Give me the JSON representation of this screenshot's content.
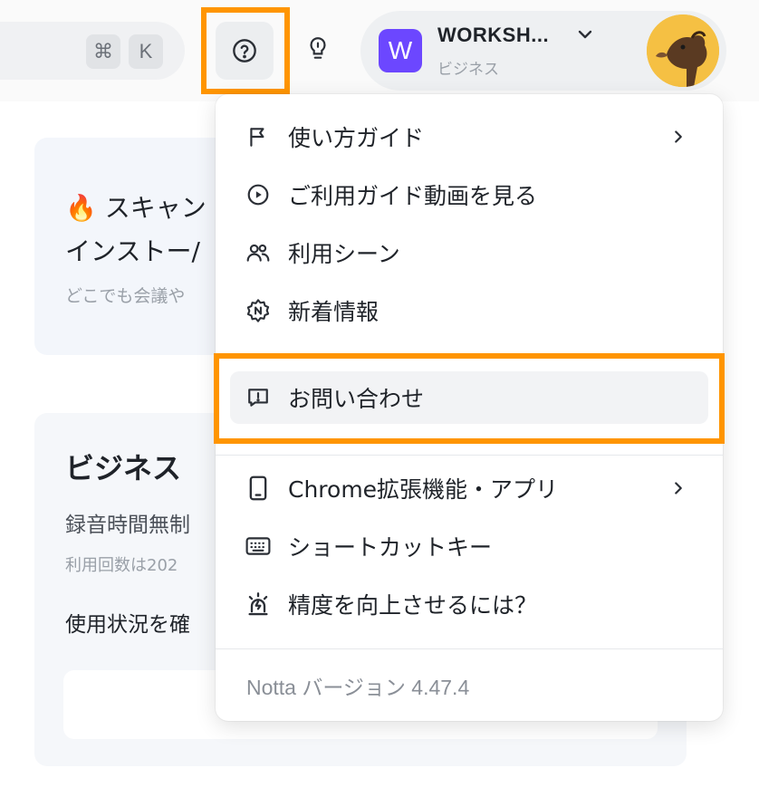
{
  "header": {
    "shortcut_keys": [
      "⌘",
      "K"
    ],
    "workspace_name": "WORKSH...",
    "workspace_logo_letter": "W",
    "workspace_plan": "ビジネス",
    "accent_color": "#6c47ff",
    "highlight_color": "#ff9500"
  },
  "background": {
    "promo_title_1": "🔥 スキャン",
    "promo_title_2": "インストー/",
    "promo_sub": "どこでも会議や",
    "plan_title": "ビジネス",
    "plan_line": "録音時間無制",
    "plan_note": "利用回数は202",
    "usage_label": "使用状況を確"
  },
  "menu": {
    "items": [
      {
        "label": "使い方ガイド",
        "icon": "flag-icon",
        "has_submenu": true
      },
      {
        "label": "ご利用ガイド動画を見る",
        "icon": "play-circle-icon",
        "has_submenu": false
      },
      {
        "label": "利用シーン",
        "icon": "users-icon",
        "has_submenu": false
      },
      {
        "label": "新着情報",
        "icon": "new-badge-icon",
        "has_submenu": false
      },
      {
        "label": "お問い合わせ",
        "icon": "message-alert-icon",
        "has_submenu": false
      },
      {
        "label": "Chrome拡張機能・アプリ",
        "icon": "phone-icon",
        "has_submenu": true
      },
      {
        "label": "ショートカットキー",
        "icon": "keyboard-icon",
        "has_submenu": false
      },
      {
        "label": "精度を向上させるには？",
        "icon": "alarm-icon",
        "has_submenu": false
      }
    ],
    "version": "Notta バージョン 4.47.4"
  }
}
